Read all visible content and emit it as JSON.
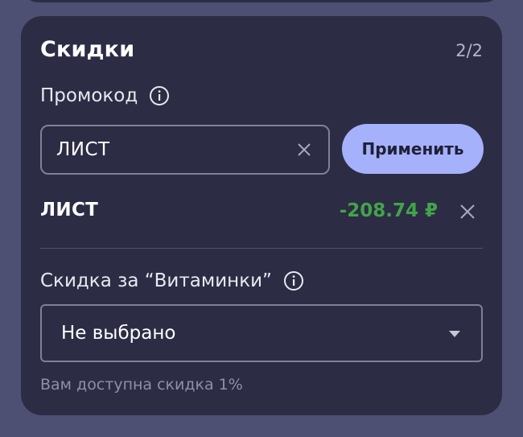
{
  "card": {
    "title": "Скидки",
    "counter": "2/2"
  },
  "promo": {
    "label": "Промокод",
    "info_icon": "info-icon",
    "input_value": "ЛИСТ",
    "clear_icon": "close-icon",
    "apply_label": "Применить",
    "applied_code": "ЛИСТ",
    "applied_amount": "-208.74 ₽",
    "remove_icon": "close-icon"
  },
  "vitamin": {
    "label": "Скидка за “Витаминки”",
    "info_icon": "info-icon",
    "selected": "Не выбрано",
    "caret_icon": "caret-down-icon",
    "hint": "Вам доступна скидка 1%"
  },
  "colors": {
    "background": "#4d5073",
    "card": "#2c2c44",
    "accent_button": "#a6b1fb",
    "discount_green": "#43a34a",
    "border": "#7f8199"
  }
}
